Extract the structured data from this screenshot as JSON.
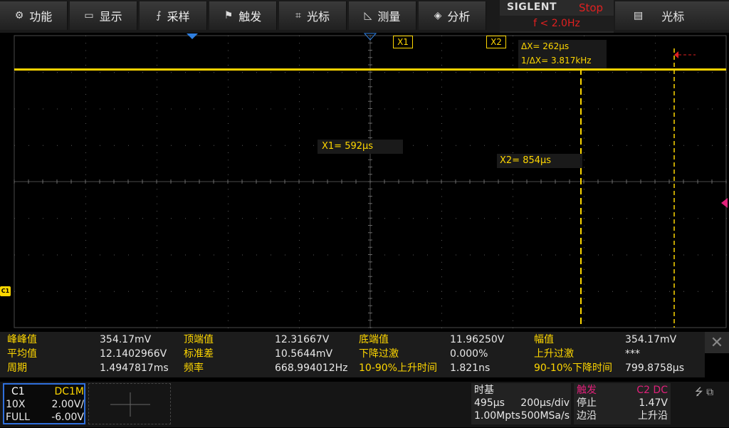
{
  "menu": [
    {
      "label": "功能",
      "icon": "gear-icon",
      "glyph": "⚙"
    },
    {
      "label": "显示",
      "icon": "display-icon",
      "glyph": "▭"
    },
    {
      "label": "采样",
      "icon": "acquire-icon",
      "glyph": "⨍"
    },
    {
      "label": "触发",
      "icon": "trigger-flag-icon",
      "glyph": "⚑"
    },
    {
      "label": "光标",
      "icon": "cursor-icon",
      "glyph": "⌗"
    },
    {
      "label": "测量",
      "icon": "measure-icon",
      "glyph": "◺"
    },
    {
      "label": "分析",
      "icon": "analyze-icon",
      "glyph": "◈"
    }
  ],
  "brand": {
    "name": "SIGLENT",
    "status": "Stop",
    "freq": "f < 2.0Hz"
  },
  "right_menu": {
    "label": "光标",
    "glyph": "▤"
  },
  "colors": {
    "trace": "#ffd700",
    "cursor": "#ffd700",
    "marker_blue": "#2f7fe0",
    "marker_magenta": "#e0207a",
    "accent_red": "#e02020"
  },
  "cursors": {
    "x1_tag": "X1",
    "x2_tag": "X2",
    "x1_value": "X1= 592μs",
    "x2_value": "X2= 854μs",
    "delta": "ΔX= 262μs",
    "inv_delta": "1/ΔX= 3.817kHz",
    "x1_time_us": 592,
    "x2_time_us": 854
  },
  "waveform": {
    "timebase_us_per_div": 200,
    "center_time_us": 0,
    "level_v": 12.14,
    "volts_per_div": 2.0,
    "offset_v": -6.0
  },
  "ch_marker": "C1",
  "measurements": [
    [
      {
        "name": "峰峰值",
        "value": "354.17mV"
      },
      {
        "name": "顶端值",
        "value": "12.31667V"
      },
      {
        "name": "底端值",
        "value": "11.96250V"
      },
      {
        "name": "幅值",
        "value": "354.17mV"
      }
    ],
    [
      {
        "name": "平均值",
        "value": "12.1402966V"
      },
      {
        "name": "标准差",
        "value": "10.5644mV"
      },
      {
        "name": "下降过激",
        "value": "0.000%"
      },
      {
        "name": "上升过激",
        "value": "***"
      }
    ],
    [
      {
        "name": "周期",
        "value": "1.4947817ms"
      },
      {
        "name": "频率",
        "value": "668.994012Hz"
      },
      {
        "name": "10-90%上升时间",
        "value": "1.821ns"
      },
      {
        "name": "90-10%下降时间",
        "value": "799.8758μs"
      }
    ]
  ],
  "close_glyph": "✕",
  "channel1": {
    "name": "C1",
    "coupling": "DC1M",
    "probe": "10X",
    "scale": "2.00V/",
    "bw": "FULL",
    "offset": "-6.00V"
  },
  "timebase": {
    "title": "时基",
    "delay": "495μs",
    "scale": "200μs/div",
    "memory": "1.00Mpts",
    "rate": "500MSa/s"
  },
  "trigger": {
    "title": "触发",
    "source": "C2 DC",
    "mode": "停止",
    "level": "1.47V",
    "type": "边沿",
    "slope": "上升沿"
  },
  "status_icons": "⭍ ⧉"
}
